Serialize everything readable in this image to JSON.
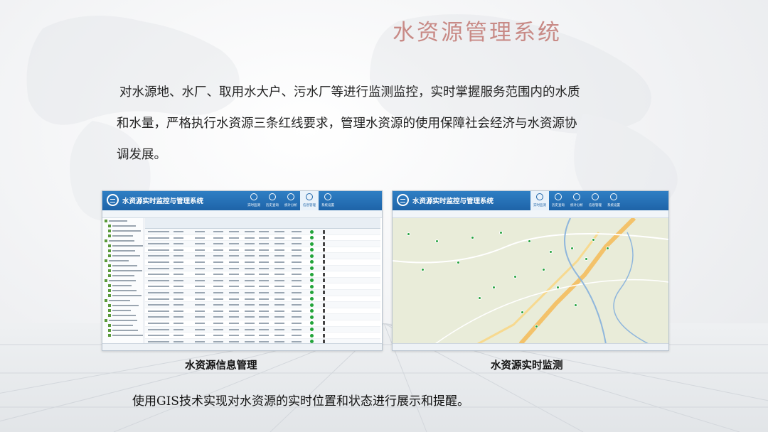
{
  "title": "水资源管理系统",
  "description": {
    "line1": "对水源地、水厂、取用水大户、污水厂等进行监测监控，实时掌握服务范围内的水质",
    "line2": "和水量，严格执行水资源三条红线要求，管理水资源的使用保障社会经济与水资源协",
    "line3": "调发展。"
  },
  "screenshots": [
    {
      "system_title": "水资源实时监控与管理系统",
      "nav": [
        "实时监测",
        "历史查询",
        "统计分析",
        "信息管理",
        "系统设置"
      ],
      "active_nav": 3,
      "caption": "水资源信息管理"
    },
    {
      "system_title": "水资源实时监控与管理系统",
      "nav": [
        "实时监测",
        "历史查询",
        "统计分析",
        "信息管理",
        "系统设置"
      ],
      "active_nav": 0,
      "caption": "水资源实时监测"
    }
  ],
  "footer_text": "使用GIS技术实现对水资源的实时位置和状态进行展示和提醒。",
  "colors": {
    "title": "#c88a86",
    "header_blue": "#1e64a8",
    "status_green": "#23a43a"
  }
}
